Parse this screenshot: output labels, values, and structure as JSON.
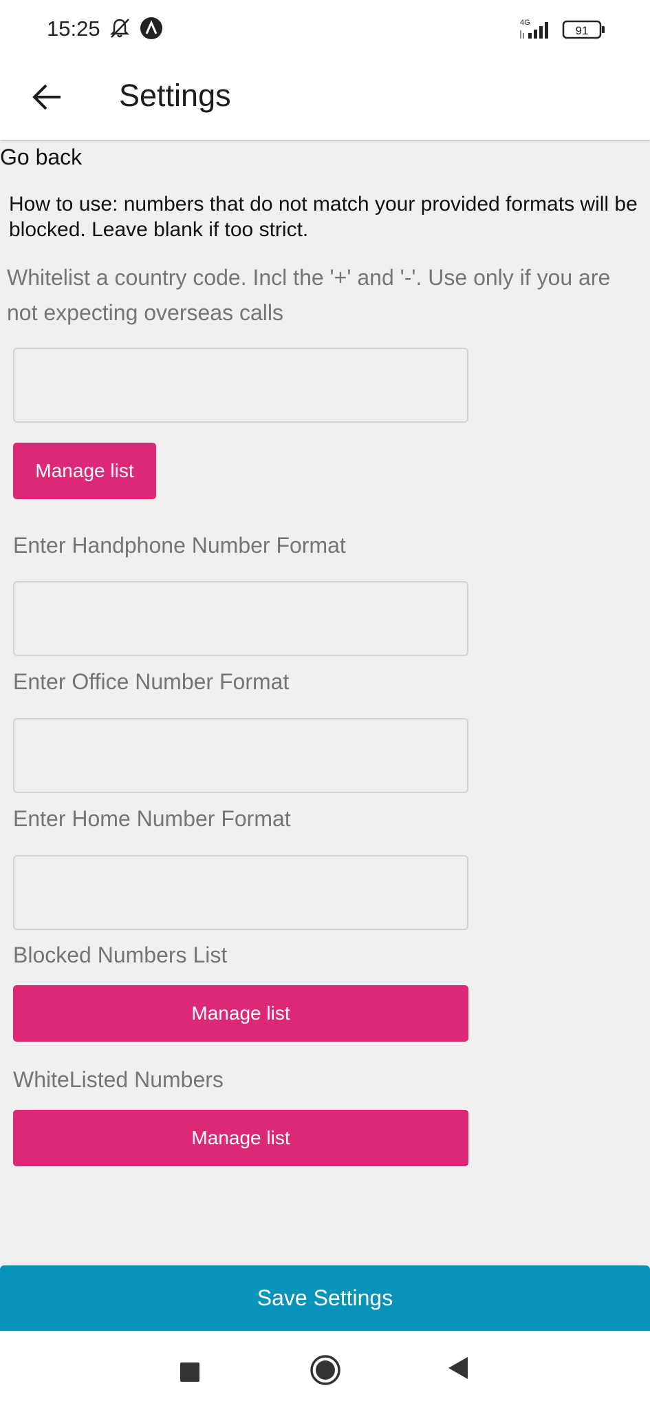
{
  "status_bar": {
    "time": "15:25",
    "network": "4G",
    "battery": "91"
  },
  "header": {
    "title": "Settings"
  },
  "content": {
    "go_back": "Go back",
    "how_to": "How to use: numbers that do not match your provided formats will be blocked. Leave blank if too strict.",
    "whitelist_label": "Whitelist a country code. Incl the '+' and '-'. Use only if you are not expecting overseas calls",
    "country_code_value": "",
    "manage_list_1": "Manage list",
    "handphone_label": "Enter Handphone Number Format",
    "handphone_value": "",
    "office_label": "Enter Office Number Format",
    "office_value": "",
    "home_label": "Enter Home Number Format",
    "home_value": "",
    "blocked_label": "Blocked Numbers List",
    "manage_list_2": "Manage list",
    "whitelisted_label": "WhiteListed Numbers",
    "manage_list_3": "Manage list",
    "save_label": "Save Settings"
  },
  "colors": {
    "accent_pink": "#dc2877",
    "save_blue": "#0993b8",
    "label_gray": "#757575"
  },
  "icons": {
    "back": "arrow-left-icon",
    "bell": "bell-off-icon",
    "app": "a-circle-icon",
    "signal": "signal-icon",
    "battery": "battery-icon",
    "recents": "square-icon",
    "home": "circle-icon",
    "nav_back": "triangle-back-icon"
  }
}
